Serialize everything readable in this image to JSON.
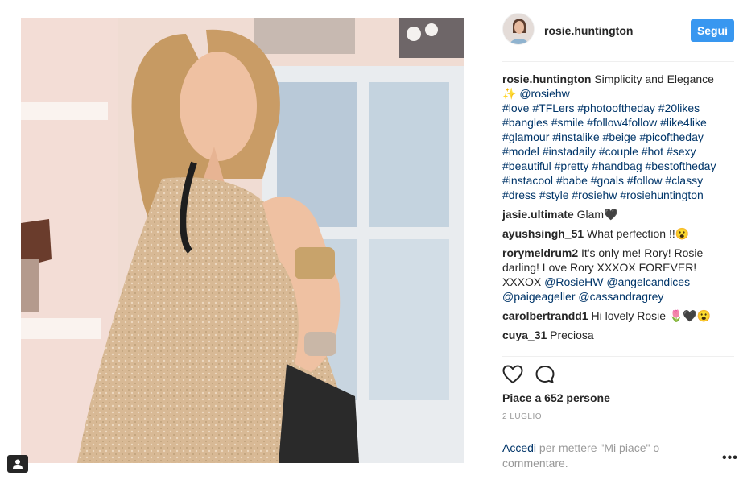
{
  "post": {
    "username": "rosie.huntington",
    "follow_label": "Segui",
    "caption": {
      "user": "rosie.huntington",
      "text": "Simplicity and Elegance",
      "emoji": "✨",
      "mention": "@rosiehw",
      "hashtags": [
        "#love",
        "#TFLers",
        "#photooftheday",
        "#20likes",
        "#bangles",
        "#smile",
        "#follow4follow",
        "#like4like",
        "#glamour",
        "#instalike",
        "#beige",
        "#picoftheday",
        "#model",
        "#instadaily",
        "#couple",
        "#hot",
        "#sexy",
        "#beautiful",
        "#pretty",
        "#handbag",
        "#bestoftheday",
        "#instacool",
        "#babe",
        "#goals",
        "#follow",
        "#classy",
        "#dress",
        "#style",
        "#rosiehw",
        "#rosiehuntington"
      ]
    },
    "comments": [
      {
        "user": "jasie.ultimate",
        "text": "Glam",
        "emoji": "🖤"
      },
      {
        "user": "ayushsingh_51",
        "text": "What perfection !!",
        "emoji": "😮"
      },
      {
        "user": "rorymeldrum2",
        "text": "It's only me! Rory! Rosie darling! Love Rory XXXOX FOREVER! XXXOX",
        "mentions": [
          "@RosieHW",
          "@angelcandices",
          "@paigeageller",
          "@cassandragrey"
        ]
      },
      {
        "user": "carolbertrandd1",
        "text": "Hi lovely Rosie",
        "emoji": "🌷🖤😮"
      },
      {
        "user": "cuya_31",
        "text": "Preciosa"
      }
    ],
    "likes_text": "Piace a 652 persone",
    "date": "2 LUGLIO",
    "login_link": "Accedi",
    "login_text": "per mettere \"Mi piace\" o commentare.",
    "more_label": "•••"
  },
  "icons": {
    "like": "heart-icon",
    "comment": "comment-icon",
    "user_tag": "user-tag-icon"
  },
  "colors": {
    "follow_button": "#3897f0",
    "link": "#003569",
    "text": "#262626",
    "muted": "#999999"
  }
}
